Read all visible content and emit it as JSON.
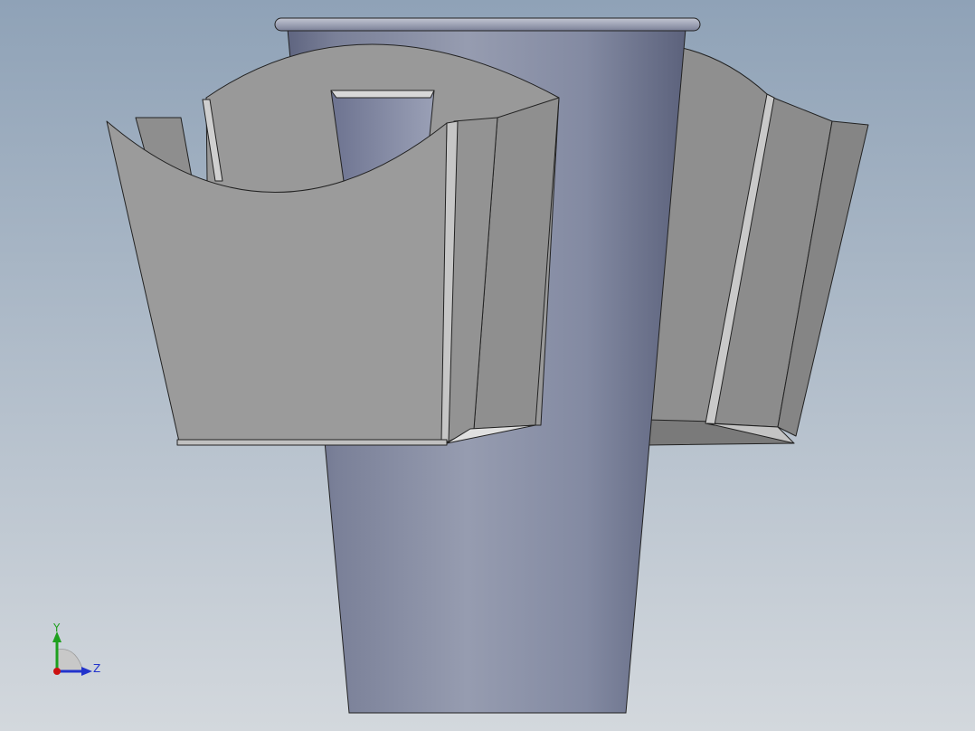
{
  "viewport": {
    "background_top": "#8fa2b7",
    "background_bottom": "#d3d8dd"
  },
  "model": {
    "cup_color": "#8a91a8",
    "holder_color": "#9b9b9b"
  },
  "triad": {
    "y_label": "Y",
    "z_label": "Z",
    "y_color": "#1ea01e",
    "z_color": "#2233cc",
    "x_color": "#cc1111"
  }
}
